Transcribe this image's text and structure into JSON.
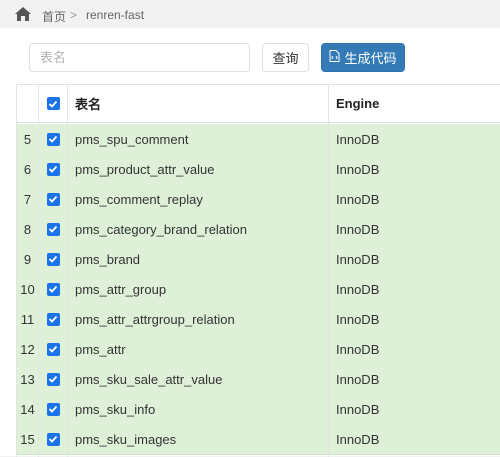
{
  "breadcrumb": {
    "home": "首页",
    "separator": ">",
    "current": "renren-fast"
  },
  "search": {
    "placeholder": "表名",
    "value": ""
  },
  "buttons": {
    "query": "查询",
    "generate": "生成代码"
  },
  "table": {
    "headers": {
      "name": "表名",
      "engine": "Engine"
    },
    "rows": [
      {
        "num": "5",
        "name": "pms_spu_comment",
        "engine": "InnoDB",
        "checked": true
      },
      {
        "num": "6",
        "name": "pms_product_attr_value",
        "engine": "InnoDB",
        "checked": true
      },
      {
        "num": "7",
        "name": "pms_comment_replay",
        "engine": "InnoDB",
        "checked": true
      },
      {
        "num": "8",
        "name": "pms_category_brand_relation",
        "engine": "InnoDB",
        "checked": true
      },
      {
        "num": "9",
        "name": "pms_brand",
        "engine": "InnoDB",
        "checked": true
      },
      {
        "num": "10",
        "name": "pms_attr_group",
        "engine": "InnoDB",
        "checked": true
      },
      {
        "num": "11",
        "name": "pms_attr_attrgroup_relation",
        "engine": "InnoDB",
        "checked": true
      },
      {
        "num": "12",
        "name": "pms_attr",
        "engine": "InnoDB",
        "checked": true
      },
      {
        "num": "13",
        "name": "pms_sku_sale_attr_value",
        "engine": "InnoDB",
        "checked": true
      },
      {
        "num": "14",
        "name": "pms_sku_info",
        "engine": "InnoDB",
        "checked": true
      },
      {
        "num": "15",
        "name": "pms_sku_images",
        "engine": "InnoDB",
        "checked": true
      }
    ]
  },
  "colors": {
    "primary": "#337ab7",
    "row_selected": "#dff0d8",
    "checkbox": "#1a73e8"
  },
  "icons": {
    "home": "home-icon",
    "generate": "code-file-icon",
    "check": "check-icon"
  }
}
